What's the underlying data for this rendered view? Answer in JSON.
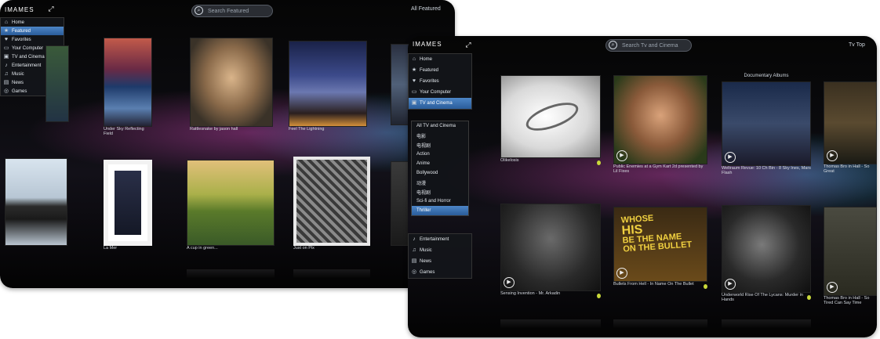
{
  "screen1": {
    "logo": "IMAMES",
    "search_placeholder": "Search Featured",
    "top_right": "All Featured",
    "sidebar": [
      {
        "icon": "⌂",
        "label": "Home"
      },
      {
        "icon": "★",
        "label": "Featured"
      },
      {
        "icon": "♥",
        "label": "Favorites"
      },
      {
        "icon": "▭",
        "label": "Your Computer"
      },
      {
        "icon": "▣",
        "label": "TV and Cinema"
      },
      {
        "icon": "♪",
        "label": "Entertainment"
      },
      {
        "icon": "♫",
        "label": "Music"
      },
      {
        "icon": "▤",
        "label": "News"
      },
      {
        "icon": "◎",
        "label": "Games"
      }
    ],
    "tiles_row1": [
      {
        "caption": "Under Sky Reflecting Field"
      },
      {
        "caption": "Rattlesnake by jason hall"
      },
      {
        "caption": "Feel The Lightning"
      },
      {
        "caption": ""
      }
    ],
    "tiles_row2": [
      {
        "caption": ""
      },
      {
        "caption": "La Mer"
      },
      {
        "caption": "A cup in green..."
      },
      {
        "caption": "Just on Pix"
      }
    ]
  },
  "screen2": {
    "logo": "IMAMES",
    "search_placeholder": "Search Tv and Cinema",
    "top_right": "Tv Top",
    "sidebar": [
      {
        "icon": "⌂",
        "label": "Home"
      },
      {
        "icon": "★",
        "label": "Featured"
      },
      {
        "icon": "♥",
        "label": "Favorites"
      },
      {
        "icon": "▭",
        "label": "Your Computer"
      },
      {
        "icon": "▣",
        "label": "TV and Cinema"
      }
    ],
    "sidebar_bottom": [
      {
        "icon": "♪",
        "label": "Entertainment"
      },
      {
        "icon": "♫",
        "label": "Music"
      },
      {
        "icon": "▤",
        "label": "News"
      },
      {
        "icon": "◎",
        "label": "Games"
      }
    ],
    "submenu": [
      "All TV and Cinema",
      "电影",
      "电视剧",
      "Action",
      "Anime",
      "Bollywood",
      "动漫",
      "电视剧",
      "Sci-fi and Horror",
      "Thriller"
    ],
    "submenu_active_index": 9,
    "tile_header": "Documentary Albums",
    "tiles_row1": [
      {
        "caption": "Olikelosis"
      },
      {
        "caption": "Public Enemies at a Gym Kart 2d presented by Lil Fixes"
      },
      {
        "caption": "Weltraum Revue: 10 Ch Bin - 8 Sky Ines, Mars Flash"
      },
      {
        "caption": "Thomas Bro in Hall - So Great"
      }
    ],
    "tiles_row2": [
      {
        "caption": "Sensing Invention - Mr. Arkadin"
      },
      {
        "caption": "Bullets From Hell - In Name On The Bullet"
      },
      {
        "caption": "Underworld Rise Of The Lycans: Murder in Hands"
      },
      {
        "caption": "Thomas Bro in Hall - So Tired Can Say Time"
      }
    ],
    "big_text": [
      "WHOSE",
      "HIS",
      "BE THE NAME",
      "ON THE BULLET"
    ]
  }
}
